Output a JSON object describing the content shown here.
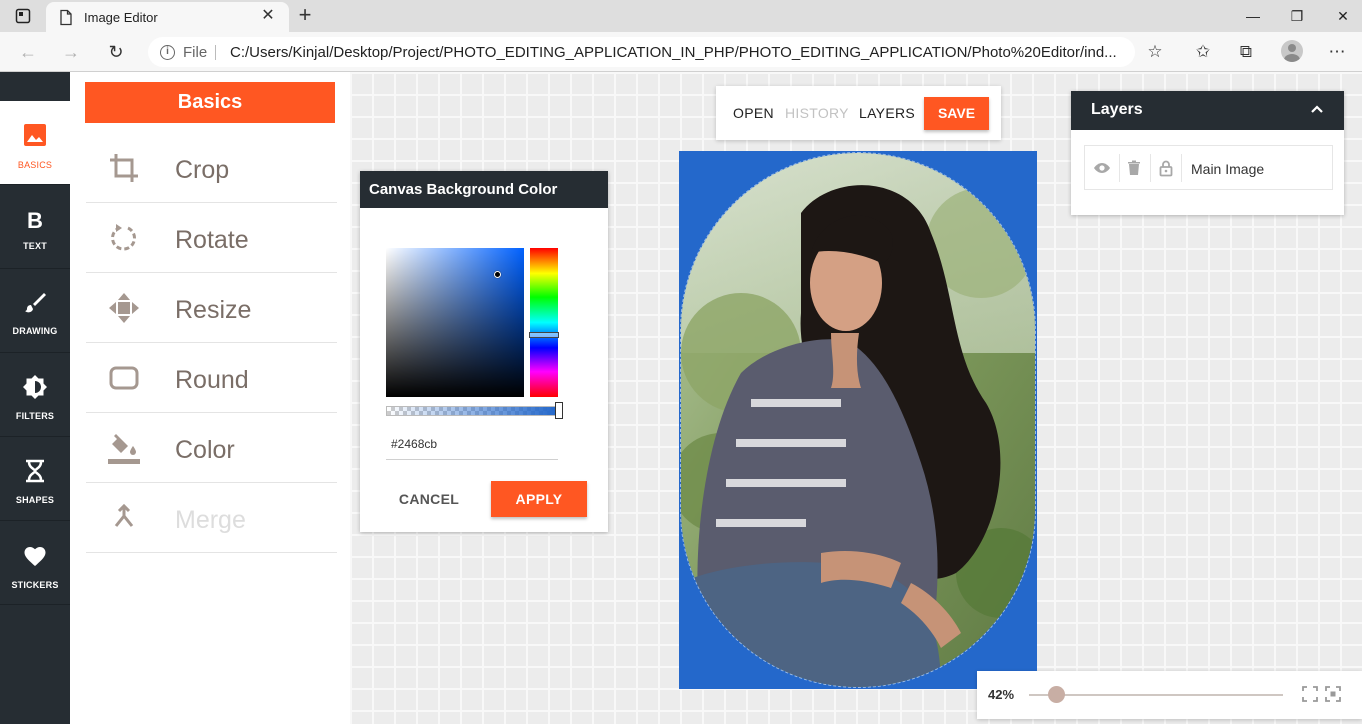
{
  "browser": {
    "tab_title": "Image Editor",
    "address_scheme": "File",
    "address_url": "C:/Users/Kinjal/Desktop/Project/PHOTO_EDITING_APPLICATION_IN_PHP/PHOTO_EDITING_APPLICATION/Photo%20Editor/ind..."
  },
  "sidebar": {
    "items": [
      {
        "label": "BASICS",
        "icon": "image-icon",
        "active": true
      },
      {
        "label": "TEXT",
        "icon": "bold-text-icon"
      },
      {
        "label": "DRAWING",
        "icon": "brush-icon"
      },
      {
        "label": "FILTERS",
        "icon": "brightness-icon"
      },
      {
        "label": "SHAPES",
        "icon": "hourglass-shape-icon"
      },
      {
        "label": "STICKERS",
        "icon": "heart-icon"
      }
    ]
  },
  "tools": {
    "header": "Basics",
    "items": [
      {
        "label": "Crop",
        "icon": "crop-icon"
      },
      {
        "label": "Rotate",
        "icon": "rotate-icon"
      },
      {
        "label": "Resize",
        "icon": "move-arrows-icon"
      },
      {
        "label": "Round",
        "icon": "rounded-rect-icon"
      },
      {
        "label": "Color",
        "icon": "paint-bucket-icon"
      },
      {
        "label": "Merge",
        "icon": "merge-icon",
        "disabled": true
      }
    ]
  },
  "color_picker": {
    "title": "Canvas Background Color",
    "hex_value": "#2468cb",
    "cancel_label": "CANCEL",
    "apply_label": "APPLY"
  },
  "top_menu": {
    "open_label": "OPEN",
    "history_label": "HISTORY",
    "layers_label": "LAYERS",
    "save_label": "SAVE"
  },
  "layers_panel": {
    "title": "Layers",
    "layers": [
      {
        "name": "Main Image"
      }
    ]
  },
  "zoom": {
    "label": "42%",
    "level_fraction": 0.11
  },
  "colors": {
    "accent": "#ff5722",
    "sidebar_bg": "#262d33",
    "canvas_bg": "#2468cb"
  }
}
